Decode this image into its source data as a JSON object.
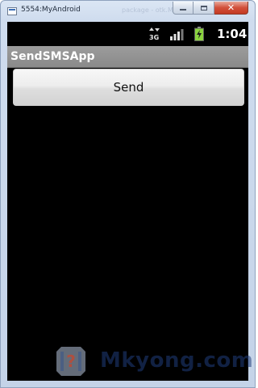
{
  "window": {
    "title": "5554:MyAndroid",
    "ghost_text": "package - otk.Mkyong",
    "minimize_label": "minimize",
    "maximize_label": "maximize",
    "close_label": "close",
    "close_glyph": "✕"
  },
  "statusbar": {
    "network_type": "3G",
    "time": "1:04",
    "icons": [
      "network-3g-icon",
      "signal-bars-icon",
      "battery-charging-icon"
    ]
  },
  "app": {
    "title": "SendSMSApp",
    "send_button_label": "Send"
  },
  "watermark": {
    "text": "Mkyong.com",
    "logo_glyph": "?"
  },
  "colors": {
    "screen_bg": "#000000",
    "appbar_bg": "#8a8a8a",
    "button_bg": "#e4e4e4",
    "battery_green": "#8bd33f",
    "watermark_blue": "#1f3d7a",
    "logo_red": "#c8462c"
  }
}
